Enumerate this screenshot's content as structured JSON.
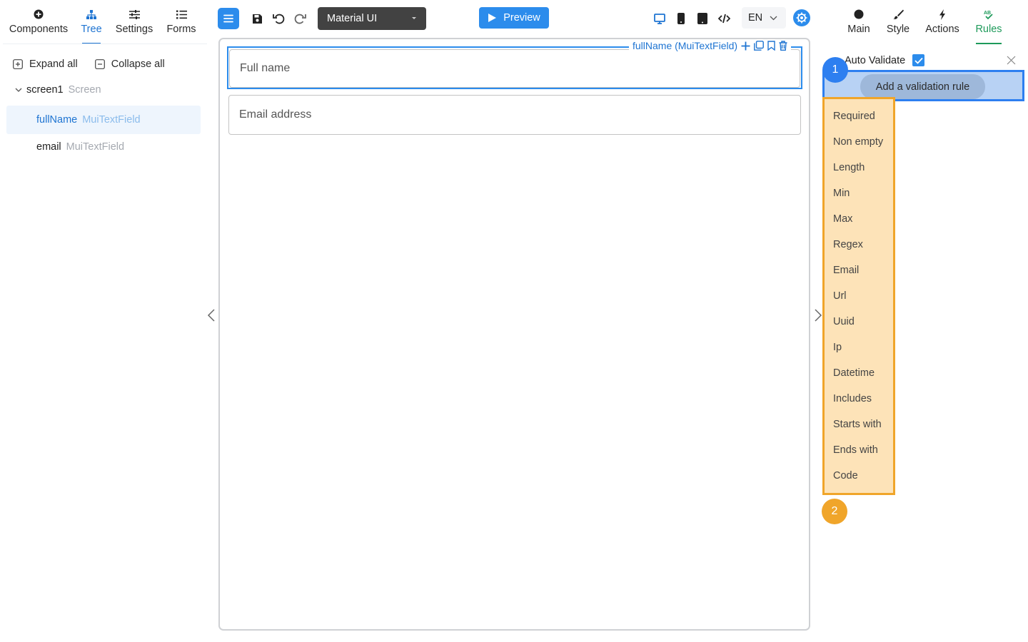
{
  "left_panel": {
    "tabs": [
      {
        "label": "Components",
        "icon": "plus-circle-icon"
      },
      {
        "label": "Tree",
        "icon": "sitemap-icon",
        "active": true
      },
      {
        "label": "Settings",
        "icon": "sliders-icon"
      },
      {
        "label": "Forms",
        "icon": "list-icon"
      }
    ],
    "expand_all": "Expand all",
    "collapse_all": "Collapse all",
    "tree": {
      "root": {
        "name": "screen1",
        "type": "Screen"
      },
      "children": [
        {
          "name": "fullName",
          "type": "MuiTextField",
          "selected": true
        },
        {
          "name": "email",
          "type": "MuiTextField"
        }
      ]
    }
  },
  "toolbar": {
    "ui_library": "Material UI",
    "preview_label": "Preview",
    "language": "EN",
    "accent_color": "#2c8cec"
  },
  "canvas": {
    "selection_tag": "fullName (MuiTextField)",
    "fields": [
      {
        "placeholder": "Full name"
      },
      {
        "placeholder": "Email address"
      }
    ]
  },
  "right_panel": {
    "tabs": [
      {
        "label": "Main",
        "icon": "circle-icon"
      },
      {
        "label": "Style",
        "icon": "brush-icon"
      },
      {
        "label": "Actions",
        "icon": "bolt-icon"
      },
      {
        "label": "Rules",
        "icon": "ab-check-icon",
        "active": true
      }
    ],
    "auto_validate_label": "Auto Validate",
    "auto_validate_checked": true,
    "add_rule_label": "Add a validation rule",
    "rules": [
      "Required",
      "Non empty",
      "Length",
      "Min",
      "Max",
      "Regex",
      "Email",
      "Url",
      "Uuid",
      "Ip",
      "Datetime",
      "Includes",
      "Starts with",
      "Ends with",
      "Code"
    ],
    "active_color": "#1e9a5a"
  },
  "annotations": {
    "badge_1": "1",
    "badge_2": "2",
    "blue": "#2d7ff0",
    "orange": "#f0a52a"
  }
}
